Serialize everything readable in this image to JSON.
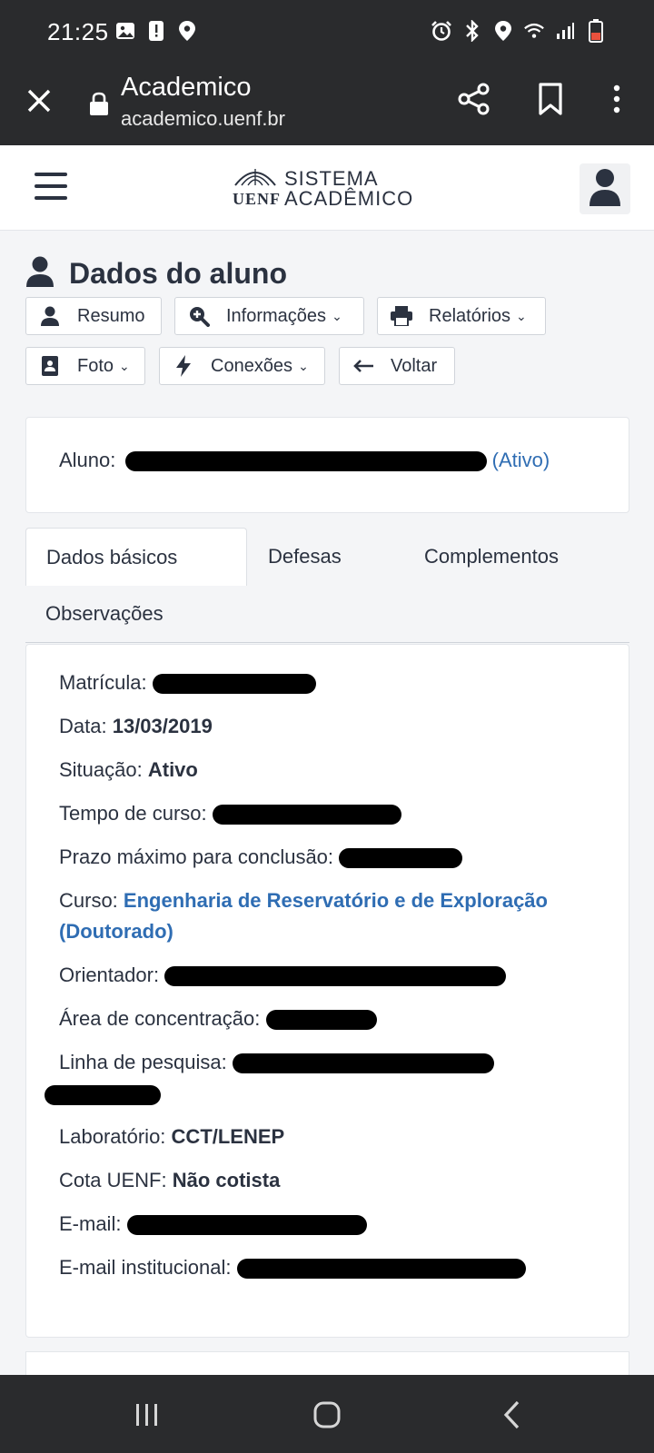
{
  "status_bar": {
    "time": "21:25",
    "left_icons": [
      "image-icon",
      "alert-icon",
      "location-icon"
    ],
    "right_icons": [
      "alarm-icon",
      "bluetooth-icon",
      "location-icon",
      "wifi-icon",
      "signal-icon",
      "battery-low-icon"
    ]
  },
  "browser": {
    "title": "Academico",
    "url": "academico.uenf.br"
  },
  "header": {
    "logo_mark_text": "UENF",
    "logo_line1": "SISTEMA",
    "logo_line2": "ACADÊMICO"
  },
  "page": {
    "title": "Dados do aluno"
  },
  "actions": {
    "resumo": "Resumo",
    "informacoes": "Informações",
    "relatorios": "Relatórios",
    "foto": "Foto",
    "conexoes": "Conexões",
    "voltar": "Voltar"
  },
  "aluno": {
    "label": "Aluno:",
    "status_suffix": "(Ativo)"
  },
  "tabs": [
    "Dados básicos",
    "Defesas",
    "Complementos",
    "Observações"
  ],
  "details": {
    "matricula_label": "Matrícula:",
    "data_label": "Data:",
    "data_value": "13/03/2019",
    "situacao_label": "Situação:",
    "situacao_value": "Ativo",
    "tempo_label": "Tempo de curso:",
    "prazo_label": "Prazo máximo para conclusão:",
    "curso_label": "Curso:",
    "curso_value_line1": "Engenharia de Reservatório e de Exploração",
    "curso_value_line2": "(Doutorado)",
    "orientador_label": "Orientador:",
    "area_label": "Área de concentração:",
    "linha_label": "Linha de pesquisa:",
    "laboratorio_label": "Laboratório:",
    "laboratorio_value": "CCT/LENEP",
    "cota_label": "Cota UENF:",
    "cota_value": "Não cotista",
    "email_label": "E-mail:",
    "email_inst_label": "E-mail institucional:"
  },
  "colors": {
    "system_bar": "#2a2b2d",
    "link": "#2f6db3",
    "text": "#2b3240",
    "redaction": "#000000"
  }
}
